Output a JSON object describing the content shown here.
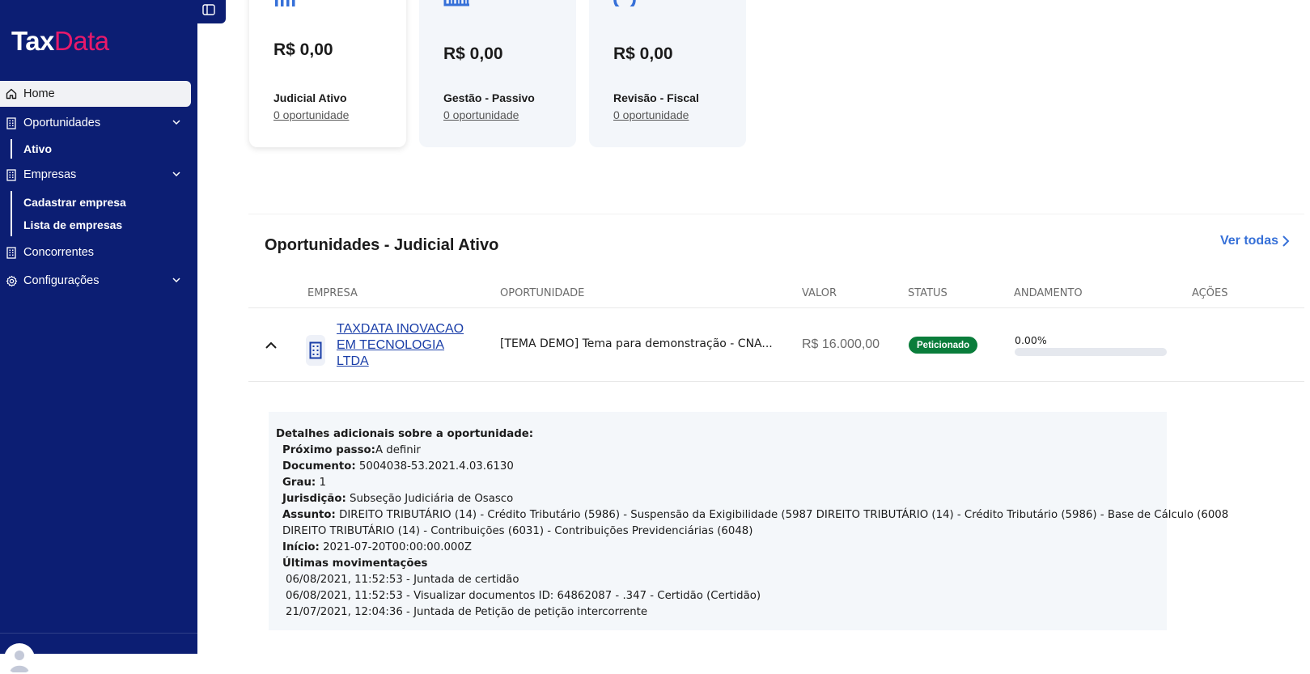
{
  "app": {
    "logo_part1": "Tax",
    "logo_part2": "Data",
    "brand_color": "#0c1e73",
    "accent_color": "#e8196b"
  },
  "sidebar": {
    "home": "Home",
    "oportunidades": "Oportunidades",
    "ativo": "Ativo",
    "empresas": "Empresas",
    "cadastrar": "Cadastrar empresa",
    "lista": "Lista de empresas",
    "concorrentes": "Concorrentes",
    "configuracoes": "Configurações"
  },
  "cards": [
    {
      "value": "R$ 0,00",
      "label": "Judicial Ativo",
      "count": "0 oportunidade",
      "icon": "bar-chart-icon"
    },
    {
      "value": "R$ 0,00",
      "label": "Gestão - Passivo",
      "count": "0 oportunidade",
      "icon": "columns-chart-icon"
    },
    {
      "value": "R$ 0,00",
      "label": "Revisão - Fiscal",
      "count": "0 oportunidade",
      "icon": "pie-chart-icon"
    }
  ],
  "section": {
    "title": "Oportunidades - Judicial Ativo",
    "see_all": "Ver todas"
  },
  "table": {
    "headers": {
      "empresa": "EMPRESA",
      "oportunidade": "OPORTUNIDADE",
      "valor": "VALOR",
      "status": "STATUS",
      "andamento": "ANDAMENTO",
      "acoes": "AÇÕES"
    },
    "row": {
      "company": "TAXDATA INOVACAO EM TECNOLOGIA LTDA",
      "opportunity": "[TEMA DEMO] Tema para demonstração - CNA...",
      "value": "R$ 16.000,00",
      "status": "Peticionado",
      "status_color": "#0a7d3b",
      "progress_label": "0.00%",
      "progress": 0
    }
  },
  "details": {
    "heading": "Detalhes adicionais sobre a oportunidade:",
    "proximo_label": "Próximo passo:",
    "proximo_value": "A definir",
    "documento_label": "Documento:",
    "documento_value": " 5004038-53.2021.4.03.6130",
    "grau_label": "Grau:",
    "grau_value": " 1",
    "jurisdicao_label": "Jurisdição:",
    "jurisdicao_value": " Subseção Judiciária de Osasco",
    "assunto_label": "Assunto:",
    "assunto_value1": " DIREITO TRIBUTÁRIO (14) - Crédito Tributário (5986) - Suspensão da Exigibilidade (5987 DIREITO TRIBUTÁRIO (14) - Crédito Tributário (5986) - Base de Cálculo (6008",
    "assunto_value2": "DIREITO TRIBUTÁRIO (14) - Contribuições (6031) - Contribuições Previdenciárias (6048)",
    "inicio_label": "Início:",
    "inicio_value": " 2021-07-20T00:00:00.000Z",
    "movimentacoes_label": "Últimas movimentações",
    "movimentacoes": [
      "06/08/2021, 11:52:53 - Juntada de certidão",
      "06/08/2021, 11:52:53 - Visualizar documentos ID: 64862087 - .347 - Certidão (Certidão)",
      "21/07/2021, 12:04:36 - Juntada de Petição de petição intercorrente"
    ]
  }
}
